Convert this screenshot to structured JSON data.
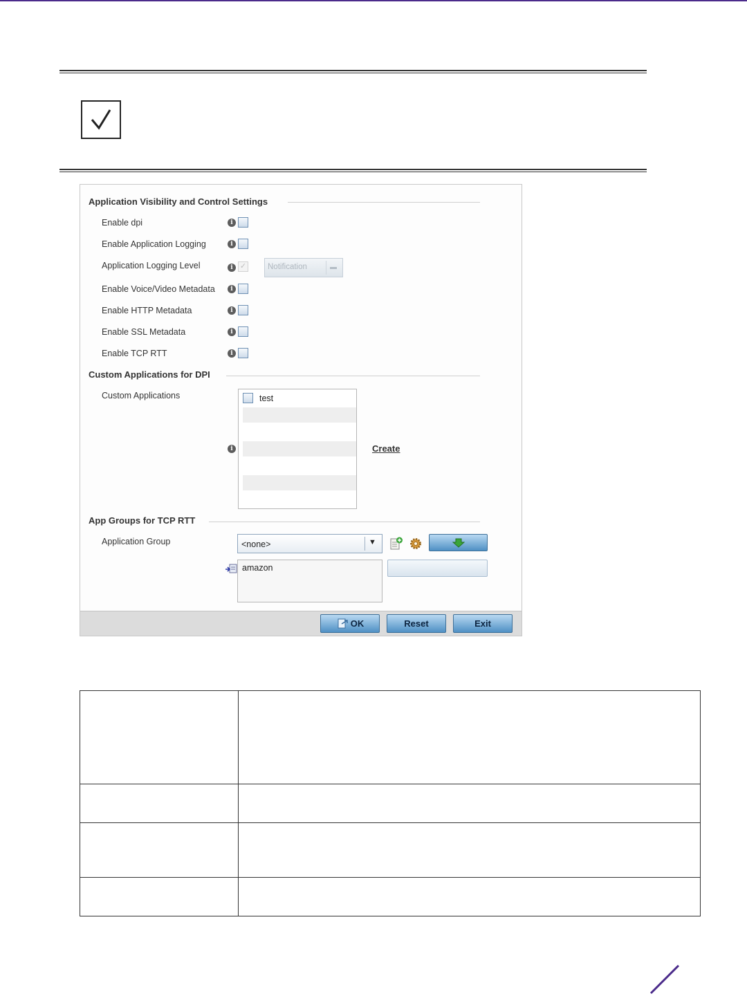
{
  "colors": {
    "accent": "#4a2a8a",
    "button_blue": "#4f90c4"
  },
  "panel": {
    "sections": {
      "avc": "Application Visibility and Control Settings",
      "custom": "Custom Applications for DPI",
      "app_groups": "App Groups for TCP RTT"
    },
    "avc_rows": [
      {
        "label": "Enable dpi"
      },
      {
        "label": "Enable Application Logging"
      },
      {
        "label": "Application Logging Level"
      },
      {
        "label": "Enable Voice/Video Metadata"
      },
      {
        "label": "Enable HTTP Metadata"
      },
      {
        "label": "Enable SSL Metadata"
      },
      {
        "label": "Enable TCP RTT"
      }
    ],
    "logging_level_value": "Notification",
    "custom_apps_label": "Custom Applications",
    "custom_apps_items": [
      "test"
    ],
    "create_link": "Create",
    "app_group_label": "Application Group",
    "app_group_selected": "<none>",
    "app_group_list": [
      "amazon"
    ],
    "buttons": {
      "ok": "OK",
      "reset": "Reset",
      "exit": "Exit"
    }
  }
}
